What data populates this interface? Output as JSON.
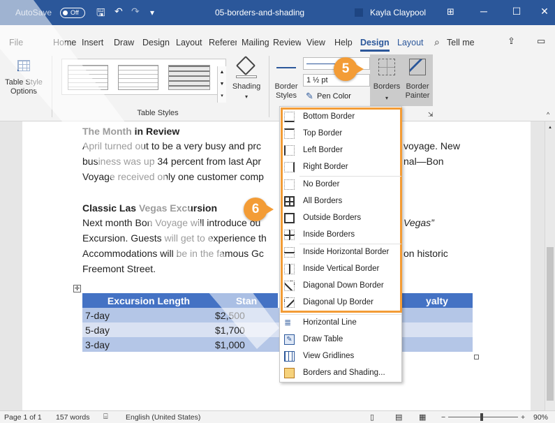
{
  "titlebar": {
    "autosave": "AutoSave",
    "toggle": "Off",
    "filename": "05-borders-and-shading",
    "user": "Kayla Claypool",
    "min": "─",
    "max": "☐",
    "close": "✕"
  },
  "tabs": [
    {
      "label": "File"
    },
    {
      "label": "Home"
    },
    {
      "label": "Insert"
    },
    {
      "label": "Draw"
    },
    {
      "label": "Design"
    },
    {
      "label": "Layout"
    },
    {
      "label": "References"
    },
    {
      "label": "Mailings"
    },
    {
      "label": "Review"
    },
    {
      "label": "View"
    },
    {
      "label": "Help"
    },
    {
      "label": "Design"
    },
    {
      "label": "Layout"
    },
    {
      "label": "Tell me"
    }
  ],
  "ribbon": {
    "table_style_options": "Table Style Options",
    "table_styles_group": "Table Styles",
    "shading": "Shading",
    "border_styles": "Border Styles",
    "line_weight": "1 ½ pt",
    "pen_color": "Pen Color",
    "borders": "Borders",
    "border_painter": "Border Painter"
  },
  "document": {
    "heading1": "The Month in Review",
    "para1": [
      "April turned out to be a very busy and prc",
      "business was up 34 percent from last Apr",
      "Voyage received only one customer comp"
    ],
    "para1_right": [
      "voyage. New",
      "nal—Bon"
    ],
    "heading2": "Classic Las Vegas Excursion",
    "para2": [
      "Next month Bon Voyage will introduce ou",
      "Excursion. Guests will get to experience th",
      "Accommodations will be in the famous Gc",
      "Freemont Street."
    ],
    "para2_right": [
      "Vegas”",
      "",
      "on historic"
    ]
  },
  "table": {
    "headers": [
      "Excursion Length",
      "Stan",
      "yalty"
    ],
    "rows": [
      [
        "7-day",
        "$2,500",
        ""
      ],
      [
        "5-day",
        "$1,700",
        ""
      ],
      [
        "3-day",
        "$1,000",
        ""
      ]
    ]
  },
  "menu": {
    "items": [
      "Bottom Border",
      "Top Border",
      "Left Border",
      "Right Border",
      "No Border",
      "All Borders",
      "Outside Borders",
      "Inside Borders",
      "Inside Horizontal Border",
      "Inside Vertical Border",
      "Diagonal Down Border",
      "Diagonal Up Border",
      "Horizontal Line",
      "Draw Table",
      "View Gridlines",
      "Borders and Shading..."
    ]
  },
  "callouts": {
    "step5": "5",
    "step6": "6"
  },
  "status": {
    "page": "Page 1 of 1",
    "words": "157 words",
    "language": "English (United States)",
    "zoom": "90%",
    "zoom_minus": "−",
    "zoom_plus": "+"
  },
  "colors": {
    "title_bar": "#2b579a",
    "callout": "#f39c36",
    "table_header": "#4472c4"
  }
}
